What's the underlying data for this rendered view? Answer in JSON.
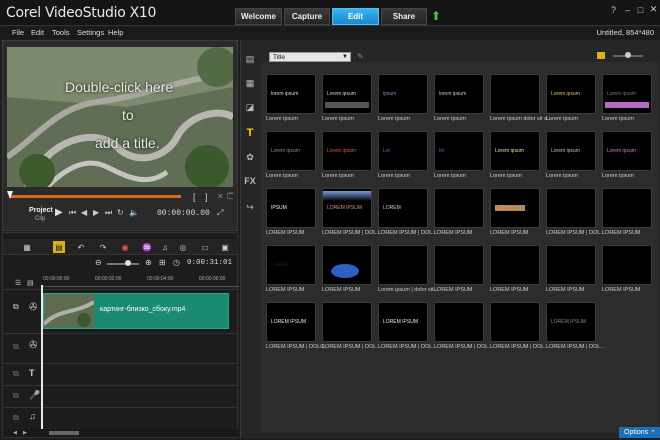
{
  "app": {
    "title": "Corel VideoStudio X10"
  },
  "tabs": [
    "Welcome",
    "Capture",
    "Edit",
    "Share"
  ],
  "menu": [
    "File",
    "Edit",
    "Tools",
    "Settings",
    "Help"
  ],
  "project_info": "Untitled, 854*480",
  "preview": {
    "overlay_line1": "Double-click here",
    "overlay_line2": "to",
    "overlay_line3": "add a title.",
    "project_label": "Project",
    "clip_label": "Clip",
    "timecode": "00:00:00.00"
  },
  "library": {
    "category": "Title",
    "options_label": "Options"
  },
  "titles": [
    {
      "caption": "Lorem ipsum",
      "preview": "lorem ipsum"
    },
    {
      "caption": "Lorem ipsum",
      "preview": "Lorem ipsum"
    },
    {
      "caption": "Lorem ipsum",
      "preview": "ipsum"
    },
    {
      "caption": "Lorem ipsum",
      "preview": "lorem ipsum"
    },
    {
      "caption": "Lorem ipsum dolor sit a...",
      "preview": ""
    },
    {
      "caption": "Lorem ipsum",
      "preview": "Lorem ipsum"
    },
    {
      "caption": "Lorem ipsum",
      "preview": "Lorem ipsum"
    },
    {
      "caption": "Lorem ipsum",
      "preview": "Lorem ipsum"
    },
    {
      "caption": "Lorem ipsum",
      "preview": "Lorem ipsum"
    },
    {
      "caption": "Lorem ipsum",
      "preview": "Lor"
    },
    {
      "caption": "Lorem ipsum",
      "preview": "lor"
    },
    {
      "caption": "Lorem ipsum",
      "preview": "Lorem ipsum"
    },
    {
      "caption": "Lorem ipsum",
      "preview": "Lorem ipsum"
    },
    {
      "caption": "Lorem ipsum",
      "preview": "Lorem ipsum"
    },
    {
      "caption": "LOREM IPSUM",
      "preview": "IPSUM"
    },
    {
      "caption": "LOREM IPSUM | DOL...",
      "preview": "LOREM IPSUM"
    },
    {
      "caption": "LOREM IPSUM | DOL...",
      "preview": "LOREM"
    },
    {
      "caption": "LOREM IPSUM",
      "preview": ""
    },
    {
      "caption": "LOREM IPSUM",
      "preview": "LOR"
    },
    {
      "caption": "LOREM IPSUM | DOL...",
      "preview": ""
    },
    {
      "caption": "LOREM IPSUM",
      "preview": ""
    },
    {
      "caption": "LOREM IPSUM",
      "preview": "LOREM"
    },
    {
      "caption": "LOREM IPSUM",
      "preview": ""
    },
    {
      "caption": "Lorem ipsum | dolor sit...",
      "preview": ""
    },
    {
      "caption": "LOREM IPSUM",
      "preview": ""
    },
    {
      "caption": "LOREM IPSUM",
      "preview": ""
    },
    {
      "caption": "LOREM IPSUM",
      "preview": ""
    },
    {
      "caption": "LOREM IPSUM",
      "preview": ""
    },
    {
      "caption": "LOREM IPSUM | DOLO...",
      "preview": "LOREM IPSUM"
    },
    {
      "caption": "LOREM IPSUM | DOL...",
      "preview": ""
    },
    {
      "caption": "LOREM IPSUM | DOL...",
      "preview": "LOREM IPSUM"
    },
    {
      "caption": "LOREM IPSUM | DOL...",
      "preview": ""
    },
    {
      "caption": "LOREM IPSUM | DOL...",
      "preview": ""
    },
    {
      "caption": "LOREM IPSUM | DOL...",
      "preview": "LOREM IPSUM"
    }
  ],
  "timeline": {
    "clip_name": "картинг-близко_сбоку.mp4",
    "ruler": [
      "00:00:00:00",
      "00:00:02:00",
      "00:00:04:00",
      "00:00:06:00"
    ],
    "timecode": "0:00:31:01"
  },
  "colors": {
    "accent": "#1b8ce0",
    "clip": "#1b8a72"
  }
}
